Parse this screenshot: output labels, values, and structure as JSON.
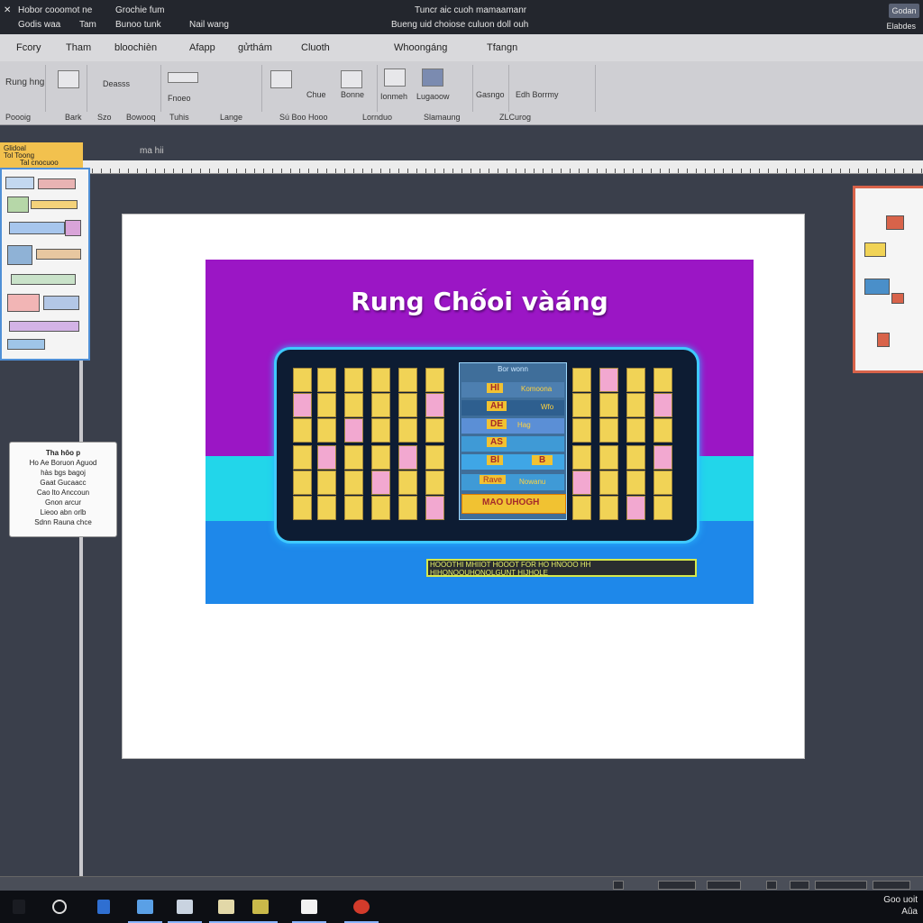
{
  "titlebar": {
    "left_text_1": "Hobor cooomot ne",
    "left_text_2": "Godis waa",
    "left_text_3": "Tam",
    "left_text_4": "Grochie fum",
    "left_text_5": "Bunoo tunk",
    "left_text_6": "Nail wang",
    "center_line_1": "Tuncr aic cuoh mamaamanr",
    "center_line_2": "Bueng uid choiose culuon doll ouh",
    "button_label": "Godan",
    "right_text": "Elabdes"
  },
  "menu": [
    "Fcory",
    "Tham",
    "bloochièn",
    "Afapp",
    "gửthám",
    "Cluoth",
    "Whoongáng",
    "Tfangn"
  ],
  "ribbon": {
    "left_label": "Rung hng",
    "group_labels": [
      "Poooig",
      "Bark",
      "Szo",
      "Bowooq",
      "Tuhis",
      "Lange",
      "Sú Boo Hooo",
      "Lornduo",
      "Slamaung",
      "ZLCurog"
    ],
    "tools": [
      "Deasss",
      "Fnoeo",
      "Chue",
      "Bonne",
      "Ionmeh",
      "Lugaoow",
      "Gasngo",
      "Edh Borrmy"
    ]
  },
  "ruler_caption": "ma hii",
  "left_pane": {
    "header_1": "Glidoal",
    "header_2": "Tol Toong",
    "header_3": "Tal cnocuoo"
  },
  "note": {
    "lines": [
      "Tha hôo p",
      "Ho Ae Boruon Aguod",
      "hàs bgs bagoj",
      "Gaat Gucaacc",
      "Cao lto Anccoun",
      "Gnon arcur",
      "Lieoo abn orlb",
      "Sdnn Rauna chce"
    ]
  },
  "slide": {
    "title": "Rung Chốoi vàáng",
    "mid_header": "Bor wonn",
    "mid_rows": [
      {
        "left": "Hl",
        "right": "Komoona"
      },
      {
        "left": "AH",
        "right": "Wfo"
      },
      {
        "left": "DE",
        "right": "Hag"
      },
      {
        "left": "AS",
        "right": ""
      },
      {
        "left": "Bl",
        "right": "B"
      },
      {
        "left": "Rave",
        "right": "Nowanu"
      },
      {
        "left": "MAO UHOGH",
        "right": ""
      }
    ],
    "footer_line_1": "HOOOTHI MHIIOT HOOOT FOR HO HNOOO HH",
    "footer_line_2": "HIHONOOUHONOLGUNT HIJHOLE"
  },
  "taskbar": {
    "clock_line_1": "Goo uoit",
    "clock_line_2": "Aûa"
  },
  "colors": {
    "slide_purple": "#9b16c5",
    "slide_cyan": "#22d6ea",
    "slide_blue": "#1e88ea",
    "tile_yellow": "#f1d356",
    "tile_pink": "#f2a8d0"
  }
}
